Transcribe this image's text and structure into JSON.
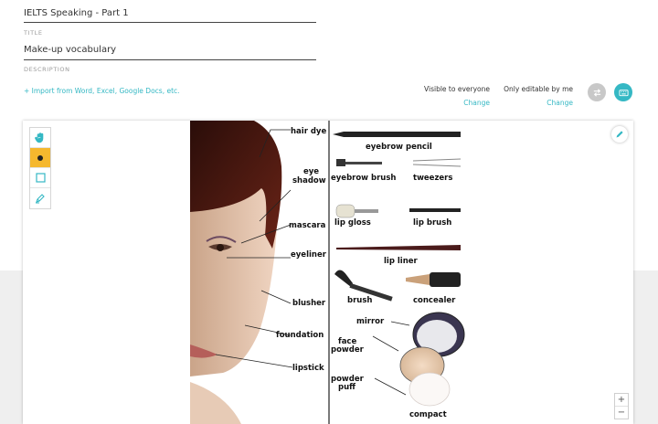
{
  "board_name": "IELTS Speaking - Part 1",
  "title": {
    "label": "TITLE",
    "value": "Make-up vocabulary"
  },
  "description": {
    "label": "DESCRIPTION"
  },
  "import_link": "+ Import from Word, Excel, Google Docs, etc.",
  "visibility": {
    "text": "Visible to everyone",
    "action": "Change"
  },
  "editability": {
    "text": "Only editable by me",
    "action": "Change"
  },
  "zoom": {
    "in": "+",
    "out": "−"
  },
  "tools": [
    {
      "icon": "hand-icon"
    },
    {
      "icon": "dot-icon"
    },
    {
      "icon": "square-icon"
    },
    {
      "icon": "pencil-icon"
    }
  ],
  "colors": {
    "accent": "#35b8c4",
    "tool_active": "#f5b82e",
    "hair": "#4a1a12"
  },
  "picture": {
    "face_labels": [
      "hair dye",
      "eye",
      "shadow",
      "mascara",
      "eyeliner",
      "blusher",
      "foundation",
      "lipstick"
    ],
    "product_labels": [
      "eyebrow pencil",
      "eyebrow brush",
      "tweezers",
      "lip gloss",
      "lip brush",
      "lip liner",
      "brush",
      "concealer",
      "mirror",
      "face",
      "powder",
      "powder",
      "puff",
      "compact"
    ]
  }
}
